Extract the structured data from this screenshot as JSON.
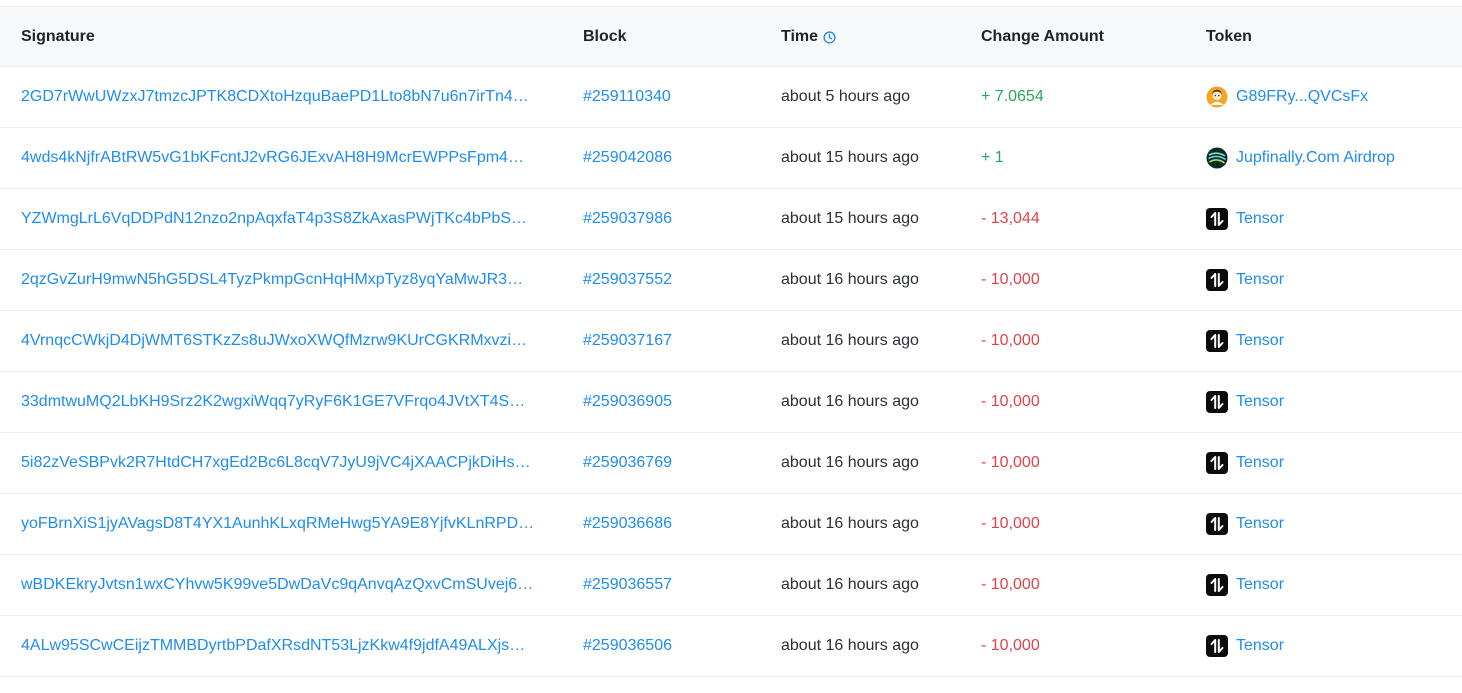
{
  "headers": {
    "signature": "Signature",
    "block": "Block",
    "time": "Time",
    "change_amount": "Change Amount",
    "token": "Token"
  },
  "colors": {
    "link": "#1f8cef",
    "positive": "#26a65b",
    "negative": "#e0424b",
    "header_bg": "#f7f8fa"
  },
  "rows": [
    {
      "signature": "2GD7rWwUWzxJ7tmzcJPTK8CDXtoHzquBaePD1Lto8bN7u6n7irTn4…",
      "block": "#259110340",
      "time": "about 5 hours ago",
      "change": "+ 7.0654",
      "sign": "positive",
      "token": "G89FRy...QVCsFx",
      "token_icon": "avatar-icon"
    },
    {
      "signature": "4wds4kNjfrABtRW5vG1bKFcntJ2vRG6JExvAH8H9McrEWPPsFpm4…",
      "block": "#259042086",
      "time": "about 15 hours ago",
      "change": "+ 1",
      "sign": "positive",
      "token": "Jupfinally.Com Airdrop",
      "token_icon": "jupiter-icon"
    },
    {
      "signature": "YZWmgLrL6VqDDPdN12nzo2npAqxfaT4p3S8ZkAxasPWjTKc4bPbS…",
      "block": "#259037986",
      "time": "about 15 hours ago",
      "change": "- 13,044",
      "sign": "negative",
      "token": "Tensor",
      "token_icon": "tensor-icon"
    },
    {
      "signature": "2qzGvZurH9mwN5hG5DSL4TyzPkmpGcnHqHMxpTyz8yqYaMwJR3…",
      "block": "#259037552",
      "time": "about 16 hours ago",
      "change": "- 10,000",
      "sign": "negative",
      "token": "Tensor",
      "token_icon": "tensor-icon"
    },
    {
      "signature": "4VrnqcCWkjD4DjWMT6STKzZs8uJWxoXWQfMzrw9KUrCGKRMxvzi…",
      "block": "#259037167",
      "time": "about 16 hours ago",
      "change": "- 10,000",
      "sign": "negative",
      "token": "Tensor",
      "token_icon": "tensor-icon"
    },
    {
      "signature": "33dmtwuMQ2LbKH9Srz2K2wgxiWqq7yRyF6K1GE7VFrqo4JVtXT4S…",
      "block": "#259036905",
      "time": "about 16 hours ago",
      "change": "- 10,000",
      "sign": "negative",
      "token": "Tensor",
      "token_icon": "tensor-icon"
    },
    {
      "signature": "5i82zVeSBPvk2R7HtdCH7xgEd2Bc6L8cqV7JyU9jVC4jXAACPjkDiHs…",
      "block": "#259036769",
      "time": "about 16 hours ago",
      "change": "- 10,000",
      "sign": "negative",
      "token": "Tensor",
      "token_icon": "tensor-icon"
    },
    {
      "signature": "yoFBrnXiS1jyAVagsD8T4YX1AunhKLxqRMeHwg5YA9E8YjfvKLnRPD…",
      "block": "#259036686",
      "time": "about 16 hours ago",
      "change": "- 10,000",
      "sign": "negative",
      "token": "Tensor",
      "token_icon": "tensor-icon"
    },
    {
      "signature": "wBDKEkryJvtsn1wxCYhvw5K99ve5DwDaVc9qAnvqAzQxvCmSUvej6…",
      "block": "#259036557",
      "time": "about 16 hours ago",
      "change": "- 10,000",
      "sign": "negative",
      "token": "Tensor",
      "token_icon": "tensor-icon"
    },
    {
      "signature": "4ALw95SCwCEijzTMMBDyrtbPDafXRsdNT53LjzKkw4f9jdfA49ALXjs…",
      "block": "#259036506",
      "time": "about 16 hours ago",
      "change": "- 10,000",
      "sign": "negative",
      "token": "Tensor",
      "token_icon": "tensor-icon"
    }
  ]
}
